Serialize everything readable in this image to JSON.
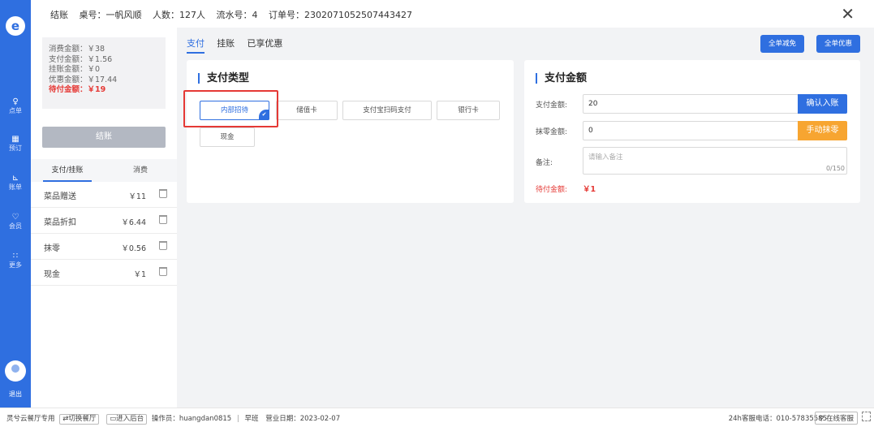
{
  "header": {
    "title": "结账",
    "table": "桌号：一帆风顺",
    "guests": "人数：127人",
    "serial": "流水号：4",
    "order": "订单号：2302071052507443427"
  },
  "nav": {
    "items": [
      "点单",
      "预订",
      "账单",
      "会员",
      "更多"
    ],
    "logout": "退出"
  },
  "summary": {
    "consume": "消费金额：￥38",
    "paid": "支付金额：￥1.56",
    "credit": "挂账金额：￥0",
    "discount": "优惠金额：￥17.44",
    "due": "待付金额：￥19"
  },
  "side": {
    "settle_label": "结账",
    "tabs": [
      "支付/挂账",
      "消费"
    ],
    "rows": [
      {
        "name": "菜品赠送",
        "amount": "￥11"
      },
      {
        "name": "菜品折扣",
        "amount": "￥6.44"
      },
      {
        "name": "抹零",
        "amount": "￥0.56"
      },
      {
        "name": "现金",
        "amount": "￥1"
      }
    ]
  },
  "main": {
    "tabs": [
      "支付",
      "挂账",
      "已享优惠"
    ],
    "btn_full_reduce": "全单减免",
    "btn_full_discount": "全单优惠"
  },
  "pay_types": {
    "title": "支付类型",
    "options": [
      "内部招待",
      "储值卡",
      "支付宝扫码支付",
      "银行卡",
      "现金"
    ],
    "selected": "内部招待"
  },
  "amount": {
    "title": "支付金额",
    "pay_label": "支付金额:",
    "pay_value": "20",
    "confirm_label": "确认入账",
    "round_label": "抹零金额:",
    "round_value": "0",
    "manual_round_label": "手动抹零",
    "note_label": "备注:",
    "note_placeholder": "请输入备注",
    "note_count": "0/150",
    "due_label": "待付金额:",
    "due_value": "￥1"
  },
  "footer": {
    "brand": "灵兮云餐厅专用",
    "switch_store": "切换餐厅",
    "enter_backend": "进入后台",
    "operator": "操作员：huangdan0815",
    "shift": "早班",
    "business_date": "营业日期：2023-02-07",
    "hotline": "24h客服电话：010-57835585",
    "online_service": "在线客服"
  },
  "colors": {
    "primary": "#2f6fe0",
    "warning": "#f7a531",
    "danger": "#e53935"
  }
}
